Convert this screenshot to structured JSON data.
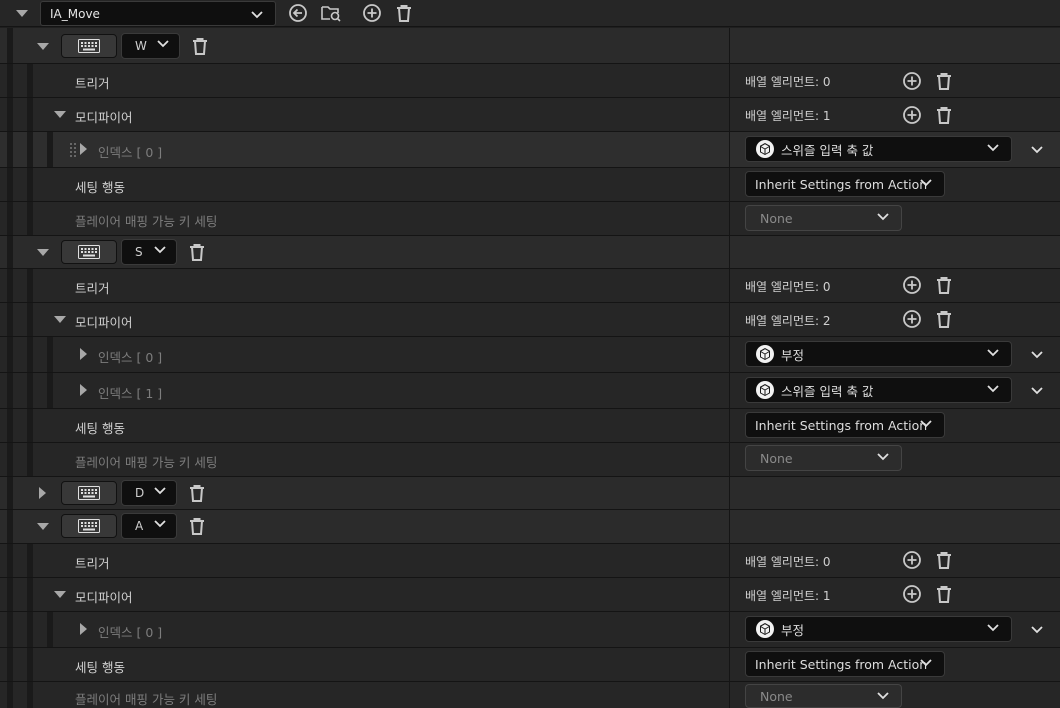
{
  "header": {
    "action_name": "IA_Move"
  },
  "mappings": [
    {
      "key": "W",
      "trigger_label": "트리거",
      "trigger_count": "배열 엘리먼트: 0",
      "modifier_label": "모디파이어",
      "modifier_count": "배열 엘리먼트: 1",
      "modifiers": [
        {
          "index_label": "인덱스 [ 0 ]",
          "value": "스위즐 입력 축 값"
        }
      ],
      "setting_behavior_label": "세팅 행동",
      "setting_behavior_value": "Inherit Settings from Action",
      "player_mappable_label": "플레이어 매핑 가능 키 세팅",
      "player_mappable_value": "None"
    },
    {
      "key": "S",
      "trigger_label": "트리거",
      "trigger_count": "배열 엘리먼트: 0",
      "modifier_label": "모디파이어",
      "modifier_count": "배열 엘리먼트: 2",
      "modifiers": [
        {
          "index_label": "인덱스 [ 0 ]",
          "value": "부정"
        },
        {
          "index_label": "인덱스 [ 1 ]",
          "value": "스위즐 입력 축 값"
        }
      ],
      "setting_behavior_label": "세팅 행동",
      "setting_behavior_value": "Inherit Settings from Action",
      "player_mappable_label": "플레이어 매핑 가능 키 세팅",
      "player_mappable_value": "None"
    },
    {
      "key": "D"
    },
    {
      "key": "A",
      "trigger_label": "트리거",
      "trigger_count": "배열 엘리먼트: 0",
      "modifier_label": "모디파이어",
      "modifier_count": "배열 엘리먼트: 1",
      "modifiers": [
        {
          "index_label": "인덱스 [ 0 ]",
          "value": "부정"
        }
      ],
      "setting_behavior_label": "세팅 행동",
      "setting_behavior_value": "Inherit Settings from Action",
      "player_mappable_label": "플레이어 매핑 가능 키 세팅",
      "player_mappable_value": "None"
    }
  ],
  "colors": {
    "panel": "#262626",
    "input_bg": "#0f0f0f",
    "text": "#d0d0d0",
    "dim_text": "#7d7d7d"
  }
}
